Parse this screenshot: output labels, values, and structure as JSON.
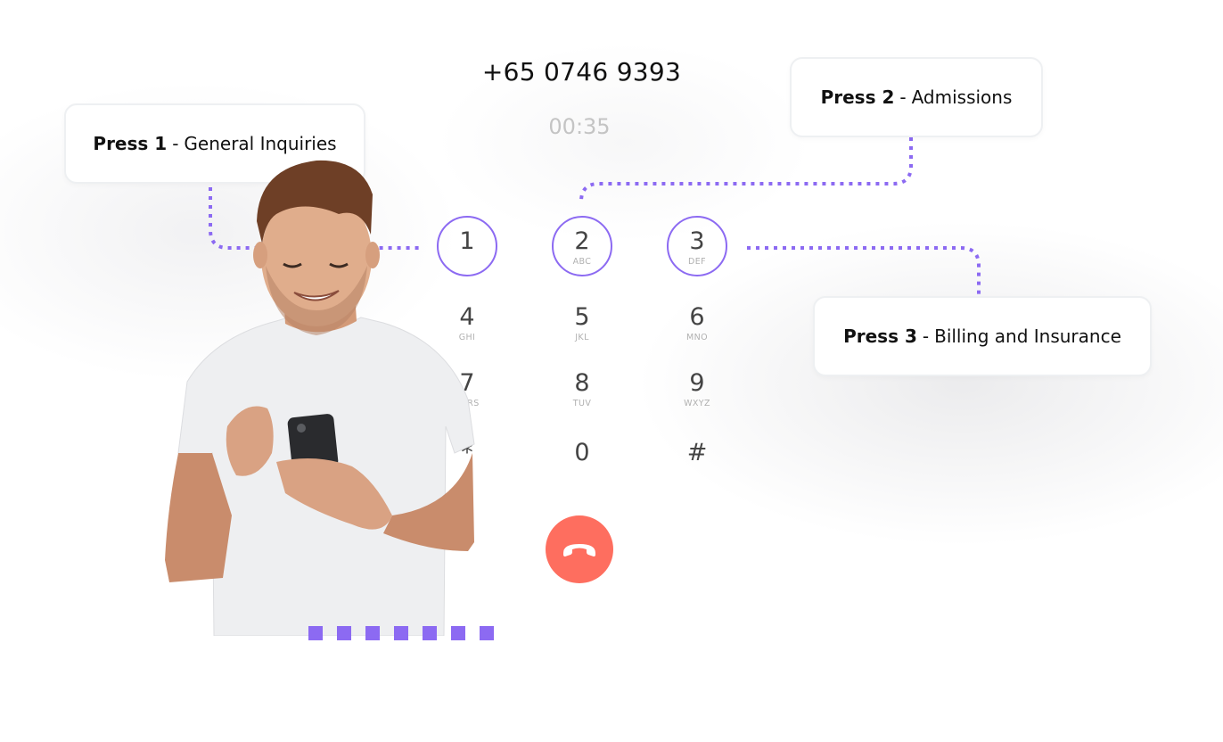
{
  "call": {
    "phone_number": "+65 0746 9393",
    "duration": "00:35"
  },
  "ivr_options": [
    {
      "key": "Press 1",
      "separator": "-",
      "label": "General Inquiries"
    },
    {
      "key": "Press 2",
      "separator": "-",
      "label": "Admissions"
    },
    {
      "key": "Press 3",
      "separator": "-",
      "label": "Billing and Insurance"
    }
  ],
  "keypad": [
    {
      "digit": "1",
      "letters": "",
      "highlighted": true
    },
    {
      "digit": "2",
      "letters": "ABC",
      "highlighted": true
    },
    {
      "digit": "3",
      "letters": "DEF",
      "highlighted": true
    },
    {
      "digit": "4",
      "letters": "GHI",
      "highlighted": false
    },
    {
      "digit": "5",
      "letters": "JKL",
      "highlighted": false
    },
    {
      "digit": "6",
      "letters": "MNO",
      "highlighted": false
    },
    {
      "digit": "7",
      "letters": "PQRS",
      "highlighted": false
    },
    {
      "digit": "8",
      "letters": "TUV",
      "highlighted": false
    },
    {
      "digit": "9",
      "letters": "WXYZ",
      "highlighted": false
    },
    {
      "digit": "*",
      "letters": "",
      "highlighted": false
    },
    {
      "digit": "0",
      "letters": "",
      "highlighted": false
    },
    {
      "digit": "#",
      "letters": "",
      "highlighted": false
    }
  ],
  "end_call": {
    "icon": "phone-hangup-icon"
  },
  "image": {
    "description": "smiling man in white t-shirt using smartphone"
  },
  "colors": {
    "accent": "#8c6af2",
    "hangup": "#fe6e5f",
    "digit": "#444444",
    "timer": "#c4c4c4"
  }
}
